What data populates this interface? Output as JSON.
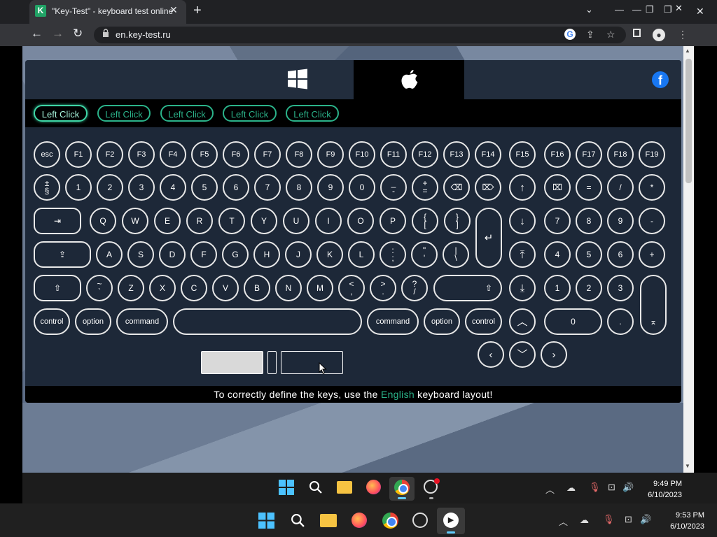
{
  "browser": {
    "tab_title": "\"Key-Test\" - keyboard test online",
    "favicon_letter": "K",
    "url": "en.key-test.ru"
  },
  "site": {
    "os_tabs": [
      "windows-logo",
      "apple-logo"
    ],
    "social": "f",
    "click_tests": [
      "Left Click",
      "Left Click",
      "Left Click",
      "Left Click",
      "Left Click"
    ],
    "keys": {
      "esc": "esc",
      "f": [
        "F1",
        "F2",
        "F3",
        "F4",
        "F5",
        "F6",
        "F7",
        "F8",
        "F9",
        "F10",
        "F11",
        "F12",
        "F13",
        "F14",
        "F15",
        "F16",
        "F17",
        "F18",
        "F19"
      ],
      "num_row": [
        "±\n§",
        "1",
        "2",
        "3",
        "4",
        "5",
        "6",
        "7",
        "8",
        "9",
        "0",
        "_\n-",
        "+\n="
      ],
      "row_q": [
        "Q",
        "W",
        "E",
        "R",
        "T",
        "Y",
        "U",
        "I",
        "O",
        "P",
        "{\n[",
        "}\n]"
      ],
      "row_a": [
        "A",
        "S",
        "D",
        "F",
        "G",
        "H",
        "J",
        "K",
        "L",
        ":\n;",
        "\"\n'",
        "|\n\\"
      ],
      "row_z": [
        "~\n`",
        "Z",
        "X",
        "C",
        "V",
        "B",
        "N",
        "M",
        "<\n,",
        ">\n.",
        "?\n/"
      ],
      "bottom": [
        "control",
        "option",
        "command",
        "command",
        "option",
        "control"
      ],
      "numpad": {
        "row1": [
          "=",
          "/",
          "*"
        ],
        "row2": [
          "7",
          "8",
          "9",
          "-"
        ],
        "row3": [
          "4",
          "5",
          "6",
          "+"
        ],
        "row4": [
          "1",
          "2",
          "3"
        ],
        "row5": [
          "0",
          "."
        ]
      }
    },
    "notice_before": "To correctly define the keys, use the ",
    "notice_highlight": "English",
    "notice_after": " keyboard layout!"
  },
  "taskbar_inner": {
    "time": "9:49 PM",
    "date": "6/10/2023"
  },
  "taskbar_outer": {
    "time": "9:53 PM",
    "date": "6/10/2023"
  },
  "colors": {
    "accent": "#2bb38a",
    "panel": "#1d2838"
  }
}
